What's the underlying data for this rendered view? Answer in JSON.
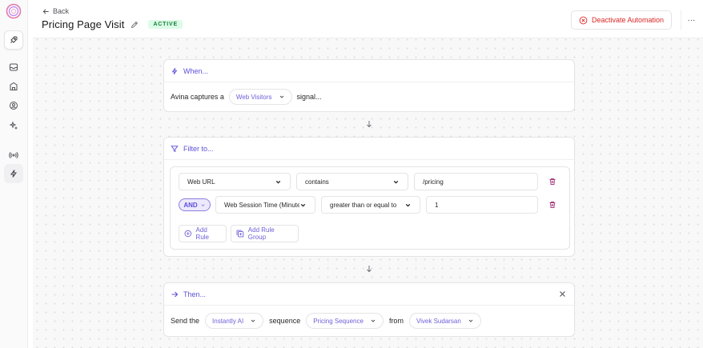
{
  "header": {
    "back_label": "Back",
    "title": "Pricing Page Visit",
    "status": "ACTIVE",
    "deactivate_label": "Deactivate Automation",
    "more_label": "···"
  },
  "colors": {
    "accent": "#5b4fd6",
    "danger": "#dc2626",
    "status_bg": "#dcfce7",
    "status_text": "#15803d"
  },
  "sidebar": {
    "items": [
      {
        "icon": "rocket-icon"
      },
      {
        "icon": "inbox-icon"
      },
      {
        "icon": "building-icon"
      },
      {
        "icon": "user-circle-icon"
      },
      {
        "icon": "sparkle-icon"
      },
      {
        "icon": "broadcast-icon"
      },
      {
        "icon": "lightning-icon"
      }
    ]
  },
  "when": {
    "heading": "When...",
    "prefix": "Avina captures a",
    "signal_type": "Web Visitors",
    "suffix": "signal..."
  },
  "filter": {
    "heading": "Filter to...",
    "rules": [
      {
        "field": "Web URL",
        "operator": "contains",
        "value": "/pricing"
      },
      {
        "field": "Web Session Time (Minutes)",
        "operator": "greater than or equal to",
        "value": "1"
      }
    ],
    "logic": "AND",
    "add_rule_label": "Add Rule",
    "add_rule_group_label": "Add Rule Group"
  },
  "then": {
    "heading": "Then...",
    "send_label": "Send the",
    "integration": "Instantly AI",
    "sequence_label": "sequence",
    "sequence": "Pricing Sequence",
    "from_label": "from",
    "sender": "Vivek Sudarsan"
  }
}
